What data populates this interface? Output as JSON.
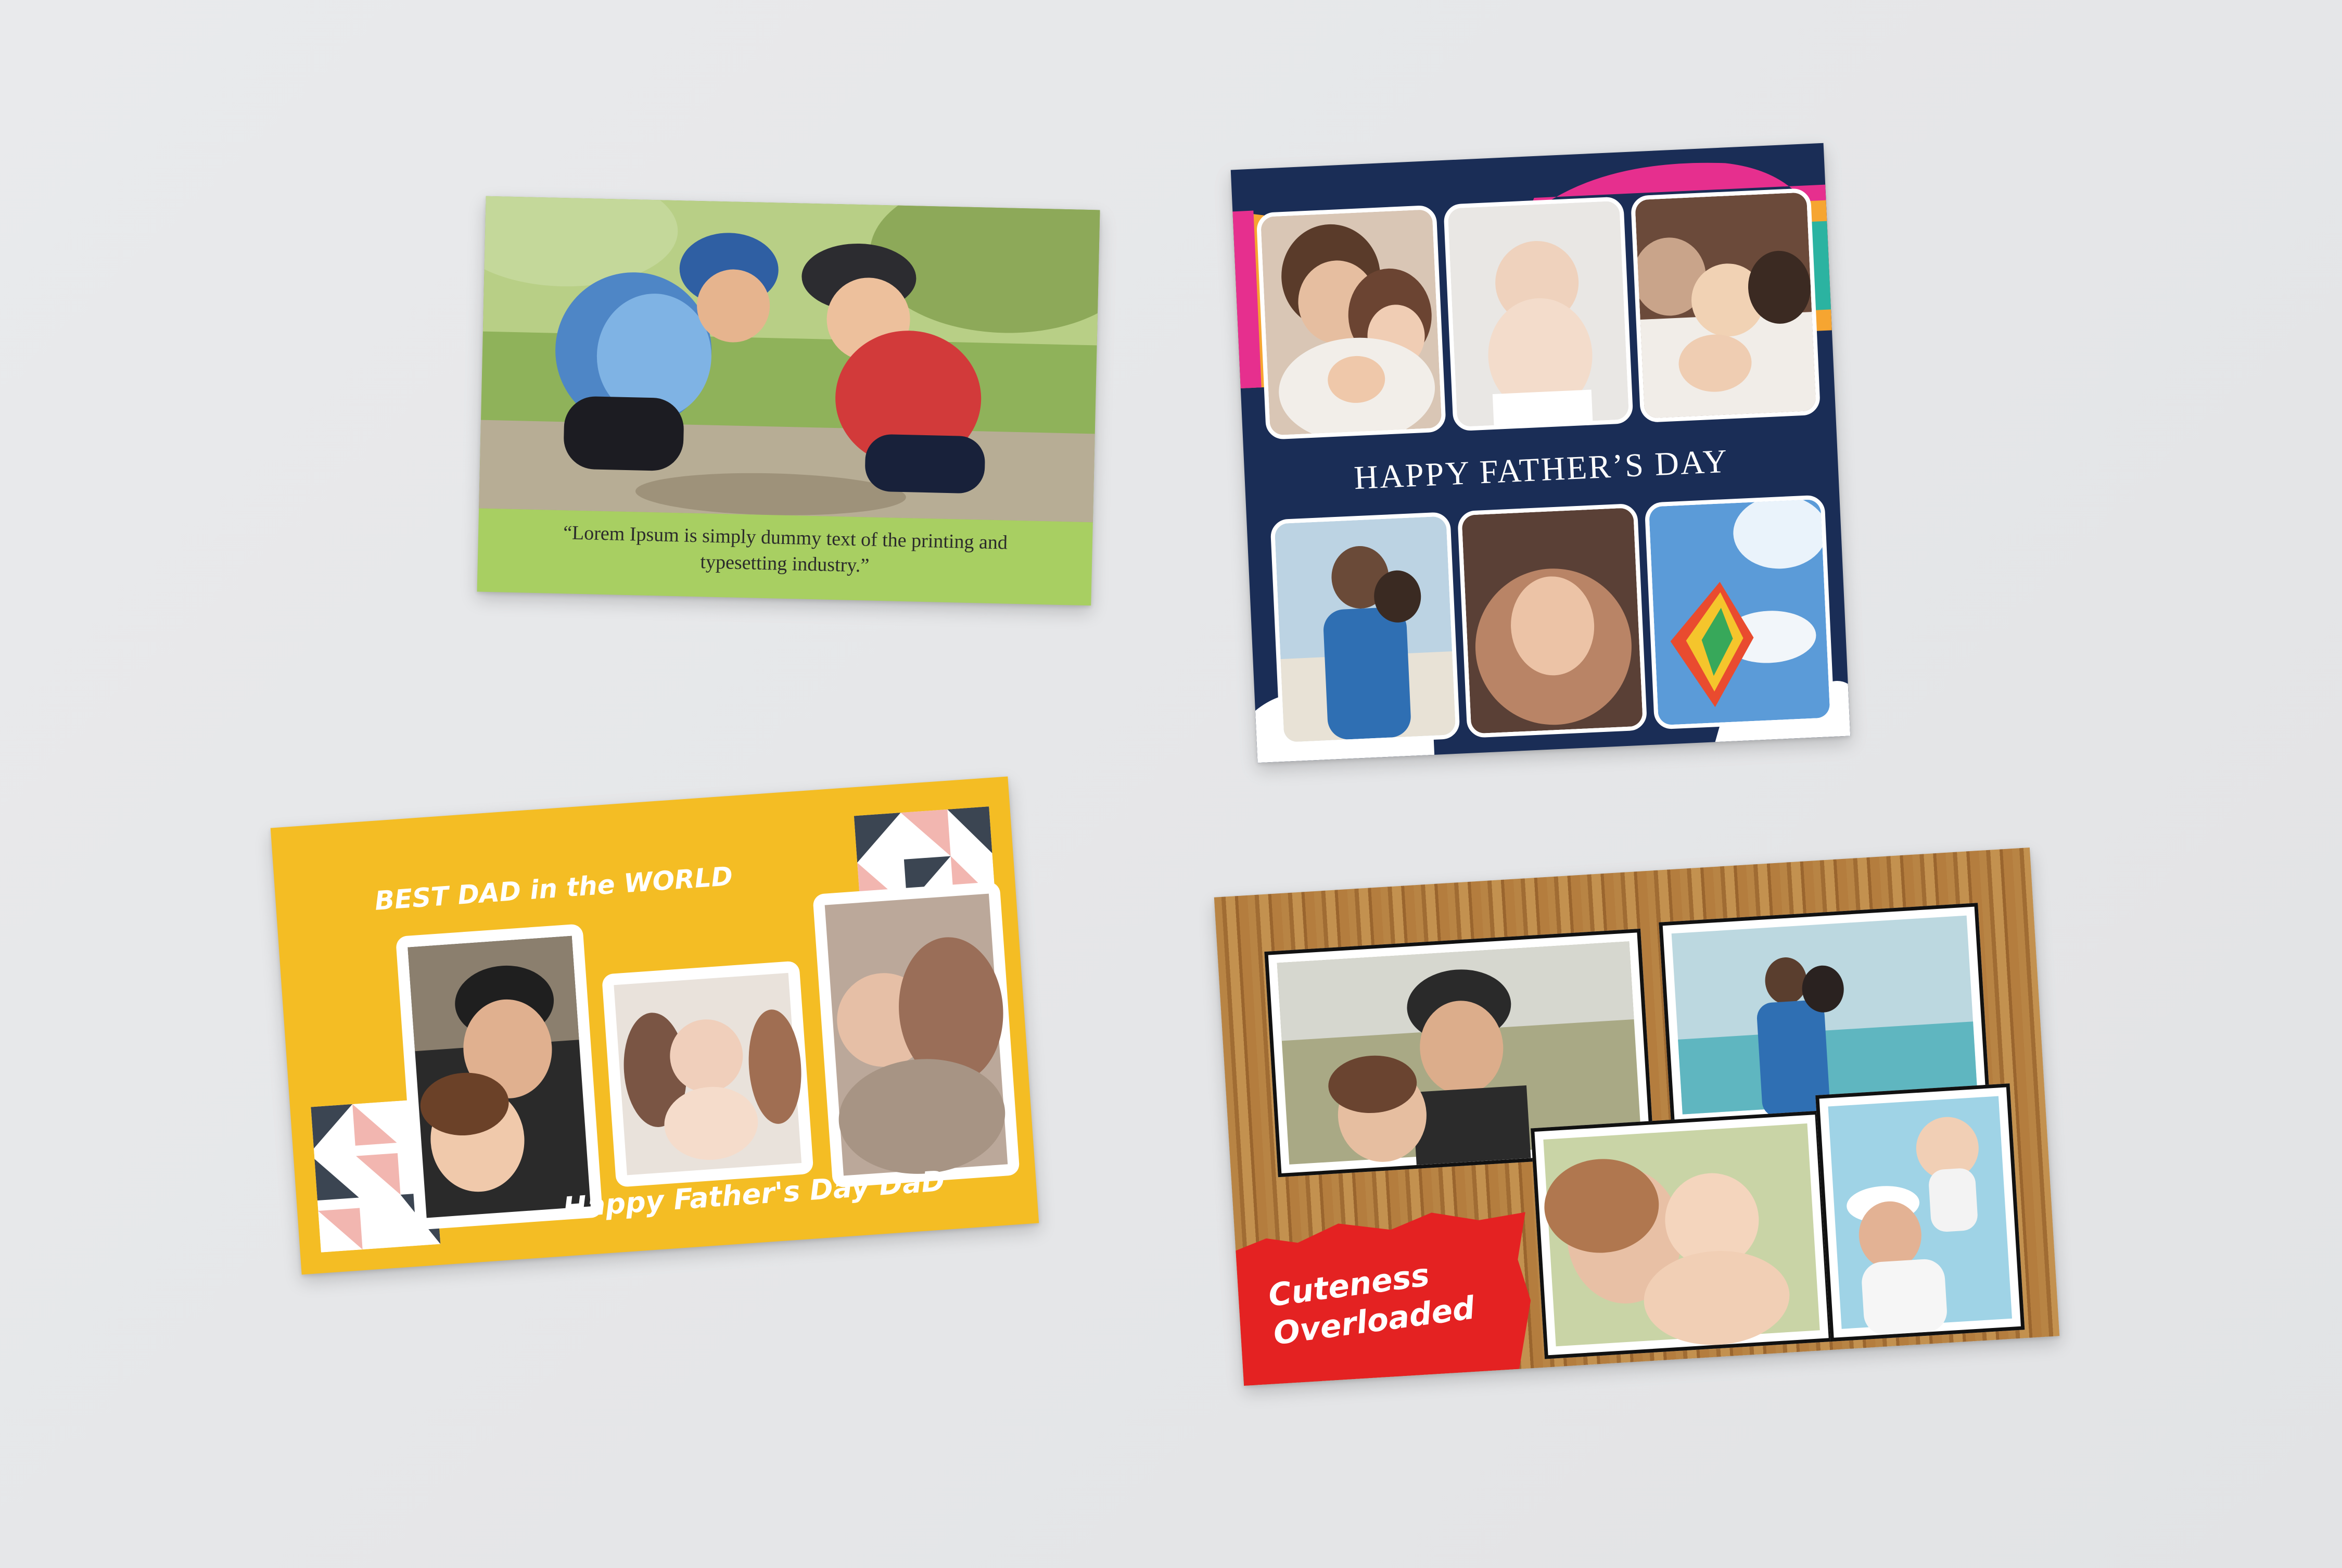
{
  "colors": {
    "background": "#e6e7e9",
    "card1_green": "#a8cf62",
    "card2_navy": "#1a2d56",
    "card2_rainbow": [
      "#e62f8e",
      "#f6a531",
      "#2bb3a1",
      "#f7d65a"
    ],
    "card3_yellow": "#f4bd24",
    "card4_wood": "#b07a3b",
    "card4_red": "#e42222"
  },
  "cards": {
    "quote_card": {
      "quote": "“Lorem Ipsum is simply dummy text of the printing and typesetting industry.”"
    },
    "fathers_day_card": {
      "title": "HAPPY FATHER’S DAY"
    },
    "best_dad_card": {
      "heading": "BEST DAD in the WORLD",
      "footer": "Happy Father's Day DaD"
    },
    "cuteness_card": {
      "caption_line1": "Cuteness",
      "caption_line2": "Overloaded"
    }
  }
}
